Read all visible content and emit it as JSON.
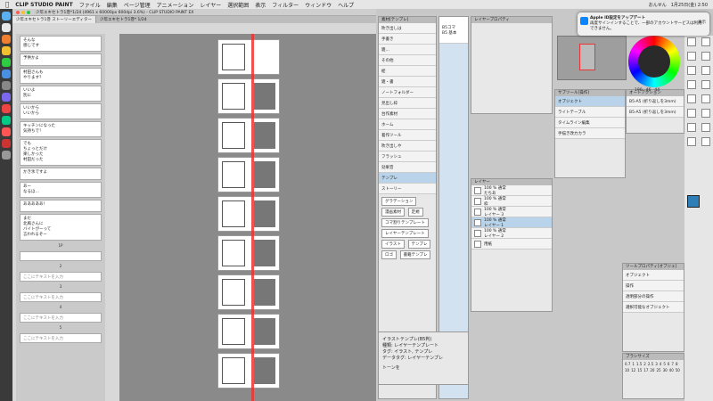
{
  "menubar": {
    "apple": "",
    "app": "CLIP STUDIO PAINT",
    "items": [
      "ファイル",
      "編集",
      "ページ管理",
      "アニメーション",
      "レイヤー",
      "選択範囲",
      "表示",
      "フィルター",
      "ウィンドウ",
      "ヘルプ"
    ],
    "right": [
      "おんせん",
      "1月25日(金)  2:50"
    ]
  },
  "window": {
    "title": "少年エキセトラ1巻*1/24 (4961 x 60000px 600dpi 3.6%) - CLIP STUDIO PAINT EX",
    "tabs": [
      "少年エキセトラ1巻 ストーリーエディター",
      "少年エキセトラ1巻* 1/24"
    ]
  },
  "story": {
    "bubbles": [
      "そんな\n感じです",
      "予供かよ",
      "村田さんも\nやります？",
      "いいよ\n別に",
      "いいから\nいいから",
      "キッチンになった\n気持ちで！",
      "でも\nちょっとだけ\n楽しかった\n村田だった",
      "かき氷ですよ",
      "あー\nなるほ…",
      "あああああ！",
      "まだ\n北風さんに\nバイトがーって\n言われるぞー"
    ],
    "separators": [
      "1P",
      "2",
      "3",
      "4",
      "5"
    ],
    "placeholder": "ここにテキストを入力"
  },
  "panels": {
    "materials_title": "素材[テンプレ]",
    "tree": [
      "吹き出しは",
      "手書き",
      "雑…",
      "その他",
      "絵",
      "雑・書",
      "ノートフォルダー",
      "見出し枠",
      "台作素材",
      "ホーム",
      "着作ツール",
      "吹き出しや",
      "フラッシュ",
      "効果音",
      "テンプレ",
      "ストーリー"
    ],
    "tags": [
      "グラデーション",
      "漫画素材",
      "定規",
      "コマ割りテンプレート",
      "レイヤーテンプレート",
      "イラスト",
      "テンプレ",
      "ロゴ",
      "書籍テンプレ"
    ],
    "template_title": "B5コマ\nB5 基本",
    "layer_prop_title": "レイヤープロパティ",
    "layers_title": "レイヤー",
    "layers": [
      {
        "label": "100 % 通常\nたちあ",
        "selected": false
      },
      {
        "label": "100 % 通常\n枠",
        "selected": false
      },
      {
        "label": "100 % 通常\nレイヤー 3",
        "selected": false
      },
      {
        "label": "100 % 通常\nレイヤー 1",
        "selected": true
      },
      {
        "label": "100 % 通常\nレイヤー 2",
        "selected": false
      },
      {
        "label": "用紙",
        "selected": false
      }
    ],
    "info": "イラストテンプレ(B5判)\n種類: レイヤーテンプレート\nタグ: イラスト, テンプレ\nデータタグ: レイヤーテンプレ",
    "tone_label": "トーンを",
    "autoaction_title": "オートアクション",
    "autoactions": [
      "B5-A5 (折り返しを3mm)",
      "B5-A5 (折り返しを3mm)"
    ],
    "toolprop_title": "ツールプロパティ[オブジェ]",
    "tool_name": "オブジェクト",
    "subtool": "操作",
    "objs": [
      "透明部分の操作",
      "選択可能なオブジェクト"
    ],
    "brush_title": "ブラシサイズ",
    "brush_sizes": [
      "0.7",
      "1",
      "1.5",
      "2",
      "2.5",
      "3",
      "4",
      "5",
      "6",
      "7",
      "8",
      "10",
      "12",
      "15",
      "17",
      "20",
      "25",
      "30",
      "40",
      "50"
    ],
    "color_values": [
      "190",
      "46",
      "44"
    ],
    "navigator_title": "ナビゲーター",
    "subtool_title": "サブツール[操作]",
    "subtool_items": [
      "オブジェクト",
      "ライトテーブル",
      "タイムライン編集",
      "手描き改力カラ"
    ]
  },
  "notification": {
    "title": "Apple ID設定をアップデート",
    "body": "再度サインインすることで、一部のアカウントサービスは利用できません。",
    "button": "表示"
  },
  "colors": {
    "accent": "#2e7eb8",
    "redline": "#e33333",
    "selected": "#b9d4ea"
  }
}
